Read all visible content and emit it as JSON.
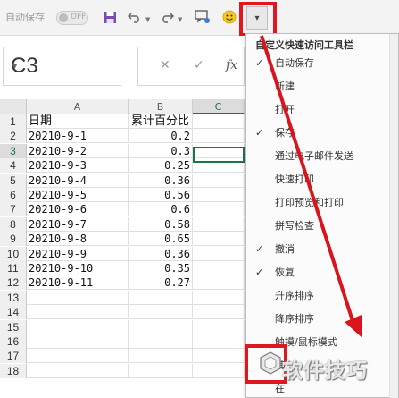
{
  "toolbar": {
    "autosave_label": "自动保存",
    "toggle_state": "OFF",
    "icons": [
      "save-icon",
      "undo-icon",
      "redo-icon",
      "comment-icon",
      "smiley-icon",
      "customize-toolbar-icon"
    ],
    "customize_glyph": "▾"
  },
  "namebox": {
    "value": "C3"
  },
  "formula": {
    "cancel": "✕",
    "enter": "✓",
    "fx": "fx"
  },
  "columns": [
    "A",
    "B",
    "C"
  ],
  "rows": [
    {
      "num": "1",
      "a": "日期",
      "b": "累计百分比"
    },
    {
      "num": "2",
      "a": "20210-9-1",
      "b": "0.2"
    },
    {
      "num": "3",
      "a": "20210-9-2",
      "b": "0.3"
    },
    {
      "num": "4",
      "a": "20210-9-3",
      "b": "0.25"
    },
    {
      "num": "5",
      "a": "20210-9-4",
      "b": "0.36"
    },
    {
      "num": "6",
      "a": "20210-9-5",
      "b": "0.56"
    },
    {
      "num": "7",
      "a": "20210-9-6",
      "b": "0.6"
    },
    {
      "num": "8",
      "a": "20210-9-7",
      "b": "0.58"
    },
    {
      "num": "9",
      "a": "20210-9-8",
      "b": "0.65"
    },
    {
      "num": "10",
      "a": "20210-9-9",
      "b": "0.36"
    },
    {
      "num": "11",
      "a": "20210-9-10",
      "b": "0.35"
    },
    {
      "num": "12",
      "a": "20210-9-11",
      "b": "0.27"
    },
    {
      "num": "13",
      "a": "",
      "b": ""
    },
    {
      "num": "14",
      "a": "",
      "b": ""
    },
    {
      "num": "15",
      "a": "",
      "b": ""
    },
    {
      "num": "16",
      "a": "",
      "b": ""
    },
    {
      "num": "17",
      "a": "",
      "b": ""
    },
    {
      "num": "18",
      "a": "",
      "b": ""
    }
  ],
  "menu": {
    "title": "自定义快速访问工具栏",
    "items": [
      {
        "label": "自动保存",
        "checked": true
      },
      {
        "label": "新建",
        "checked": false
      },
      {
        "label": "打开",
        "checked": false
      },
      {
        "label": "保存",
        "checked": true
      },
      {
        "label": "通过电子邮件发送",
        "checked": false
      },
      {
        "label": "快速打印",
        "checked": false
      },
      {
        "label": "打印预览和打印",
        "checked": false
      },
      {
        "label": "拼写检查",
        "checked": false
      },
      {
        "label": "撤消",
        "checked": true
      },
      {
        "label": "恢复",
        "checked": true
      },
      {
        "label": "升序排序",
        "checked": false
      },
      {
        "label": "降序排序",
        "checked": false
      },
      {
        "label": "触摸/鼠标模式",
        "checked": false
      },
      {
        "label": "其",
        "checked": false
      },
      {
        "label": "在",
        "checked": false
      }
    ]
  },
  "watermark": {
    "text": "软件技巧"
  },
  "colors": {
    "accent_green": "#217346",
    "highlight_red": "#e0171f"
  }
}
